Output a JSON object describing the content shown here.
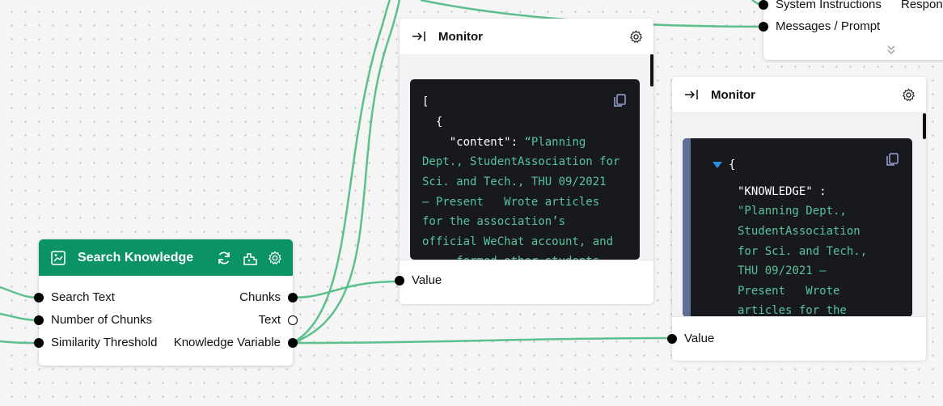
{
  "top_node": {
    "input_1": "System Instructions",
    "output_1": "Respon",
    "input_2": "Messages / Prompt"
  },
  "search_knowledge": {
    "title": "Search Knowledge",
    "inputs": [
      "Search Text",
      "Number of Chunks",
      "Similarity Threshold"
    ],
    "outputs": [
      "Chunks",
      "Text",
      "Knowledge Variable"
    ],
    "header_color": "#0b9266"
  },
  "monitor_1": {
    "title": "Monitor",
    "code_lines": [
      "[",
      "  {",
      "    \"content\": ",
      "Planning",
      "Dept., StudentAssociation for",
      "Sci. and Tech., THU 09/2021",
      "– Present   Wrote articles",
      "for the association’s",
      "official WeChat account, and",
      "...  formed other students"
    ],
    "value_label": "Value"
  },
  "monitor_2": {
    "title": "Monitor",
    "code_open": "{",
    "code_key": "\"KNOWLEDGE\" :",
    "code_lines": [
      "\"Planning Dept.,",
      "StudentAssociation",
      "for Sci. and Tech.,",
      "THU 09/2021 –",
      "Present   Wrote",
      "articles for the"
    ],
    "value_label": "Value"
  },
  "colors": {
    "edge": "#5cc08c",
    "canvas": "#f5f5f6",
    "code_bg": "#17191e",
    "code_string": "#58c398",
    "tree_bar": "#5e6e94"
  }
}
